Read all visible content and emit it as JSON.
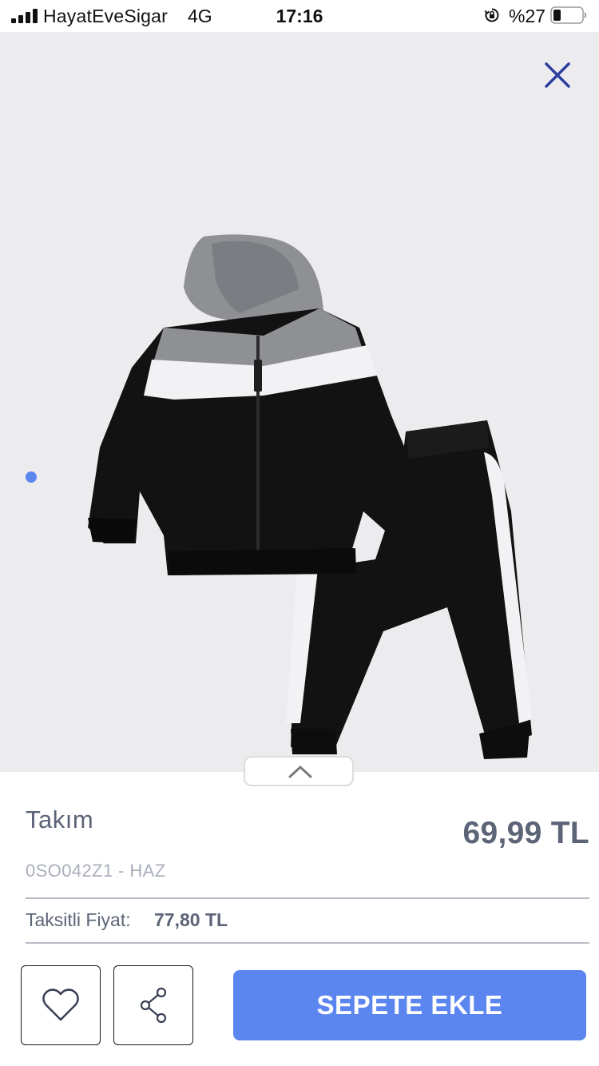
{
  "status_bar": {
    "carrier": "HayatEveSigar",
    "network": "4G",
    "time": "17:16",
    "battery": "%27"
  },
  "gallery": {
    "active_index": 0,
    "dot_color": "#5b86ef"
  },
  "product": {
    "title": "Takım",
    "price": "69,99 TL",
    "code": "0SO042Z1 - HAZ",
    "installment_label": "Taksitli Fiyat:",
    "installment_price": "77,80 TL"
  },
  "actions": {
    "add_to_cart_label": "SEPETE EKLE",
    "favorite_icon": "heart-icon",
    "share_icon": "share-icon"
  },
  "colors": {
    "accent": "#5b86ef",
    "close_icon": "#2f3f9e",
    "text": "#5c6478",
    "image_background": "#ececef"
  }
}
